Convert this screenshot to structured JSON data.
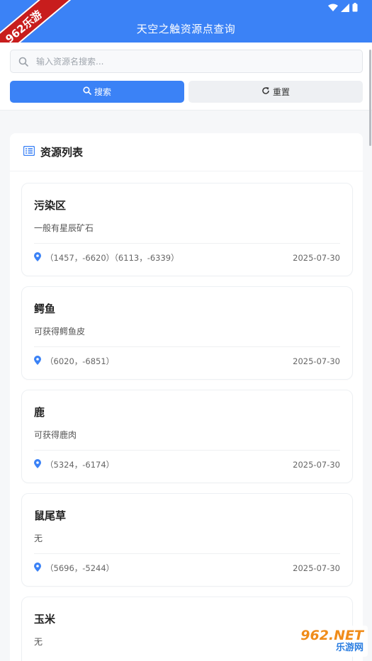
{
  "app": {
    "title": "天空之触资源点查询"
  },
  "ribbon": {
    "text": "962乐游"
  },
  "search": {
    "placeholder": "输入资源名搜索...",
    "value": ""
  },
  "buttons": {
    "search_label": "搜索",
    "reset_label": "重置"
  },
  "list": {
    "title": "资源列表",
    "items": [
      {
        "name": "污染区",
        "desc": "一般有星辰矿石",
        "coords": "（1457，-6620）（6113，-6339）",
        "date": "2025-07-30"
      },
      {
        "name": "鳄鱼",
        "desc": "可获得鳄鱼皮",
        "coords": "（6020，-6851）",
        "date": "2025-07-30"
      },
      {
        "name": "鹿",
        "desc": "可获得鹿肉",
        "coords": "（5324，-6174）",
        "date": "2025-07-30"
      },
      {
        "name": "鼠尾草",
        "desc": "无",
        "coords": "（5696，-5244）",
        "date": "2025-07-30"
      },
      {
        "name": "玉米",
        "desc": "无",
        "coords": "",
        "date": ""
      }
    ]
  },
  "watermark": {
    "brand": "962.NET",
    "sub": "乐游网"
  },
  "colors": {
    "primary": "#3b82f6",
    "location_icon": "#3b82f6",
    "ribbon": "#c81d1d"
  }
}
